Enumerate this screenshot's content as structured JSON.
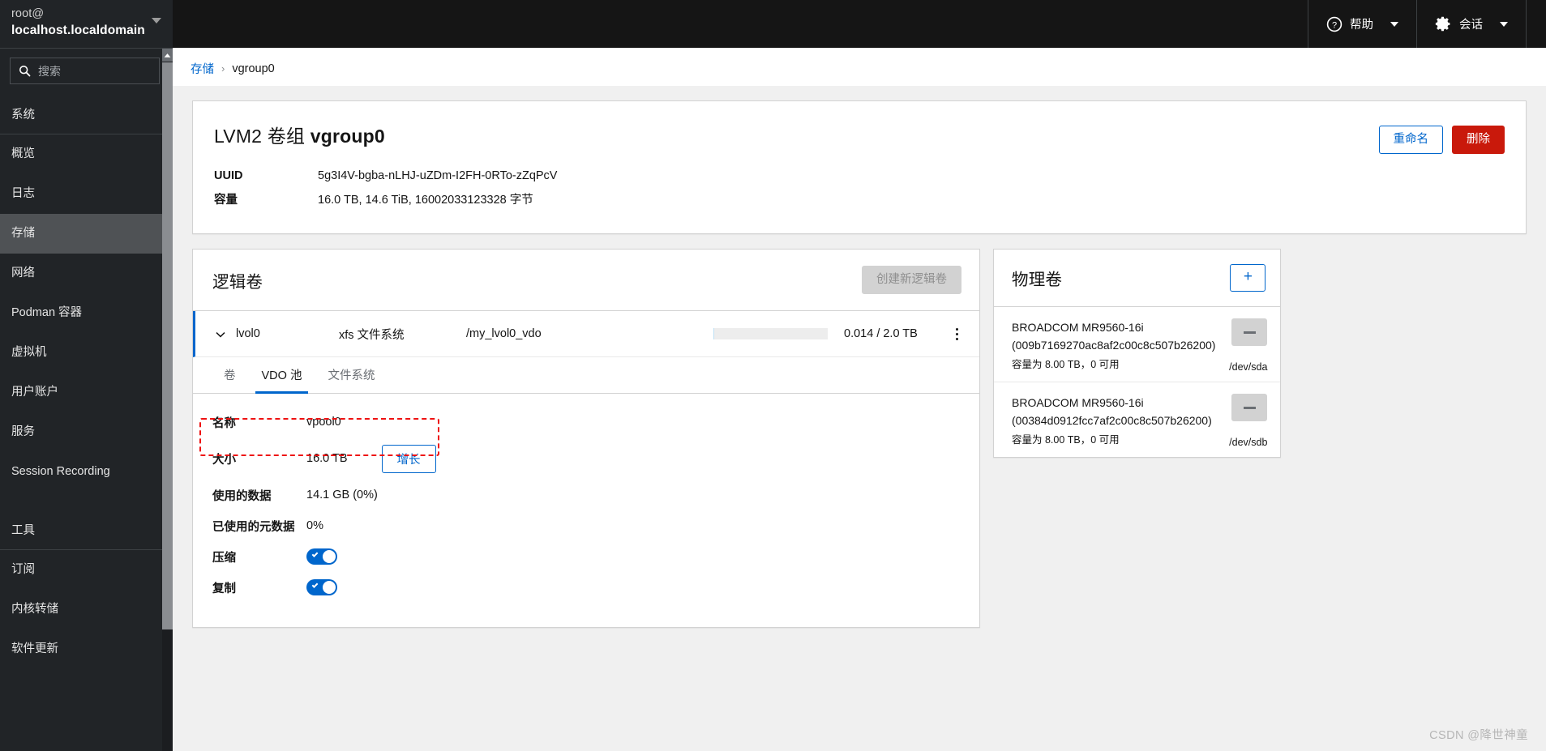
{
  "sidebar": {
    "host_user": "root@",
    "host_name": "localhost.localdomain",
    "search_placeholder": "搜索",
    "search_value": "",
    "section_system": "系统",
    "items": [
      {
        "label": "概览",
        "active": false
      },
      {
        "label": "日志",
        "active": false
      },
      {
        "label": "存储",
        "active": true
      },
      {
        "label": "网络",
        "active": false
      },
      {
        "label": "Podman 容器",
        "active": false
      },
      {
        "label": "虚拟机",
        "active": false
      },
      {
        "label": "用户账户",
        "active": false
      },
      {
        "label": "服务",
        "active": false
      },
      {
        "label": "Session Recording",
        "active": false
      }
    ],
    "section_tools": "工具",
    "tool_items": [
      {
        "label": "订阅"
      },
      {
        "label": "内核转储"
      },
      {
        "label": "软件更新"
      }
    ]
  },
  "topbar": {
    "help_label": "帮助",
    "session_label": "会话"
  },
  "breadcrumb": {
    "root": "存储",
    "separator": "›",
    "current": "vgroup0"
  },
  "vgroup": {
    "title_prefix": "LVM2 卷组 ",
    "title_name": "vgroup0",
    "uuid_label": "UUID",
    "uuid_value": "5g3I4V-bgba-nLHJ-uZDm-I2FH-0RTo-zZqPcV",
    "capacity_label": "容量",
    "capacity_value": "16.0 TB, 14.6 TiB, 16002033123328 字节",
    "rename_label": "重命名",
    "delete_label": "删除"
  },
  "logical_volumes": {
    "title": "逻辑卷",
    "create_label": "创建新逻辑卷",
    "create_disabled": true,
    "row": {
      "name": "lvol0",
      "filesystem": "xfs 文件系统",
      "mountpoint": "/my_lvol0_vdo",
      "usage_percent": 0.7,
      "usage_text": "0.014 / 2.0 TB"
    },
    "tabs": [
      {
        "label": "卷",
        "active": false
      },
      {
        "label": "VDO 池",
        "active": true
      },
      {
        "label": "文件系统",
        "active": false
      }
    ],
    "vdo_pool": {
      "name_label": "名称",
      "name_value": "vpool0",
      "size_label": "大小",
      "size_value": "16.0 TB",
      "grow_label": "增长",
      "used_data_label": "使用的数据",
      "used_data_value": "14.1 GB (0%)",
      "used_meta_label": "已使用的元数据",
      "used_meta_value": "0%",
      "compression_label": "压缩",
      "compression_on": true,
      "dedup_label": "复制",
      "dedup_on": true
    }
  },
  "physical_volumes": {
    "title": "物理卷",
    "add_label": "+",
    "items": [
      {
        "name": "BROADCOM MR9560-16i (009b7169270ac8af2c00c8c507b26200)",
        "capacity": "容量为 8.00 TB，0 可用",
        "device": "/dev/sda"
      },
      {
        "name": "BROADCOM MR9560-16i (00384d0912fcc7af2c00c8c507b26200)",
        "capacity": "容量为 8.00 TB，0 可用",
        "device": "/dev/sdb"
      }
    ]
  },
  "watermark": "CSDN @降世神童",
  "colors": {
    "accent": "#0066cc",
    "danger": "#c9190b",
    "sidebar_bg": "#212427",
    "highlight": "#ee1111"
  }
}
